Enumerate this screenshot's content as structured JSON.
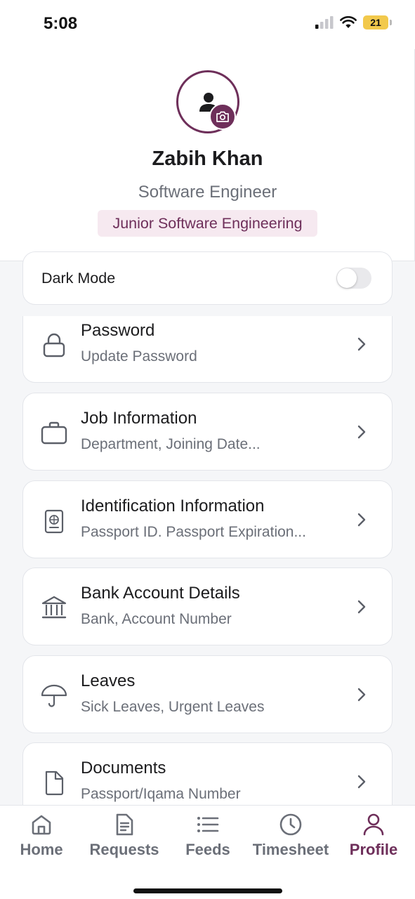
{
  "status_bar": {
    "time": "5:08",
    "battery": "21"
  },
  "profile": {
    "name": "Zabih Khan",
    "title": "Software Engineer",
    "badge": "Junior Software Engineering",
    "accent_color": "#6e2f5a"
  },
  "settings": {
    "dark_mode_label": "Dark Mode",
    "dark_mode_on": false
  },
  "menu": [
    {
      "icon": "lock-icon",
      "title": "Password",
      "subtitle": "Update Password"
    },
    {
      "icon": "briefcase-icon",
      "title": "Job Information",
      "subtitle": "Department, Joining Date..."
    },
    {
      "icon": "passport-icon",
      "title": "Identification Information",
      "subtitle": "Passport ID. Passport Expiration..."
    },
    {
      "icon": "bank-icon",
      "title": "Bank Account Details",
      "subtitle": "Bank, Account Number"
    },
    {
      "icon": "umbrella-icon",
      "title": "Leaves",
      "subtitle": "Sick Leaves, Urgent Leaves"
    },
    {
      "icon": "document-icon",
      "title": "Documents",
      "subtitle": "Passport/Iqama Number"
    }
  ],
  "nav": [
    {
      "label": "Home",
      "icon": "home-icon"
    },
    {
      "label": "Requests",
      "icon": "requests-icon"
    },
    {
      "label": "Feeds",
      "icon": "feeds-icon"
    },
    {
      "label": "Timesheet",
      "icon": "clock-icon"
    },
    {
      "label": "Profile",
      "icon": "user-icon",
      "active": true
    }
  ]
}
